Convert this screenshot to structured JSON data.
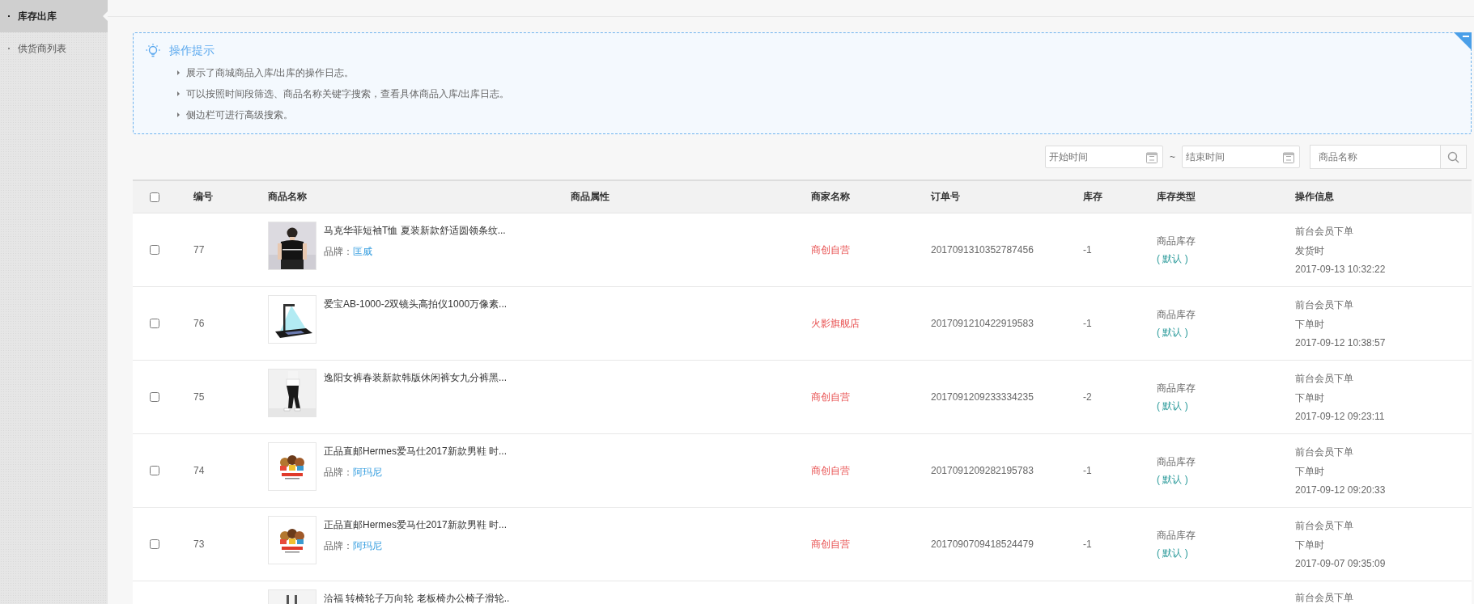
{
  "sidebar": {
    "items": [
      {
        "label": "库存出库",
        "selected": true
      },
      {
        "label": "供货商列表",
        "selected": false
      }
    ]
  },
  "tips": {
    "title": "操作提示",
    "lines": [
      "展示了商城商品入库/出库的操作日志。",
      "可以按照时间段筛选、商品名称关键字搜索，查看具体商品入库/出库日志。",
      "侧边栏可进行高级搜索。"
    ]
  },
  "filters": {
    "start_placeholder": "开始时间",
    "separator": "~",
    "end_placeholder": "结束时间",
    "search_placeholder": "商品名称"
  },
  "table": {
    "select_all": {
      "checked": false
    },
    "columns": [
      "编号",
      "商品名称",
      "商品属性",
      "商家名称",
      "订单号",
      "库存",
      "库存类型",
      "操作信息"
    ],
    "rows": [
      {
        "checked": false,
        "id": "77",
        "image": {
          "kind": "picture"
        },
        "name": "马克华菲短袖T恤 夏装新款舒适圆领条纹...",
        "brand_label": "品牌：",
        "brand": "匡威",
        "shop": "商创自营",
        "order": "2017091310352787456",
        "stock": "-1",
        "stock_type": "商品库存",
        "stock_note": "( 默认 )",
        "op": [
          "前台会员下单",
          "发货时",
          "2017-09-13 10:32:22"
        ]
      },
      {
        "checked": false,
        "id": "76",
        "image": {
          "kind": "picture"
        },
        "name": "爱宝AB-1000-2双镜头高拍仪1000万像素...",
        "shop": "火影旗舰店",
        "order": "2017091210422919583",
        "stock": "-1",
        "stock_type": "商品库存",
        "stock_note": "( 默认 )",
        "op": [
          "前台会员下单",
          "下单时",
          "2017-09-12 10:38:57"
        ]
      },
      {
        "checked": false,
        "id": "75",
        "image": {
          "kind": "picture"
        },
        "name": "逸阳女裤春装新款韩版休闲裤女九分裤黑...",
        "shop": "商创自营",
        "order": "2017091209233334235",
        "stock": "-2",
        "stock_type": "商品库存",
        "stock_note": "( 默认 )",
        "op": [
          "前台会员下单",
          "下单时",
          "2017-09-12 09:23:11"
        ]
      },
      {
        "checked": false,
        "id": "74",
        "image": {
          "kind": "picture"
        },
        "name": "正品直邮Hermes爱马仕2017新款男鞋 时...",
        "brand_label": "品牌：",
        "brand": "阿玛尼",
        "shop": "商创自营",
        "order": "2017091209282195783",
        "stock": "-1",
        "stock_type": "商品库存",
        "stock_note": "( 默认 )",
        "op": [
          "前台会员下单",
          "下单时",
          "2017-09-12 09:20:33"
        ]
      },
      {
        "checked": false,
        "id": "73",
        "image": {
          "kind": "picture"
        },
        "name": "正品直邮Hermes爱马仕2017新款男鞋 时...",
        "brand_label": "品牌：",
        "brand": "阿玛尼",
        "shop": "商创自营",
        "order": "2017090709418524479",
        "stock": "-1",
        "stock_type": "商品库存",
        "stock_note": "( 默认 )",
        "op": [
          "前台会员下单",
          "下单时",
          "2017-09-07 09:35:09"
        ]
      },
      {
        "image": {
          "kind": "picture"
        },
        "name": "洽福 转椅轮子万向轮 老板椅办公椅子滑轮..",
        "op": [
          "前台会员下单"
        ]
      }
    ]
  }
}
